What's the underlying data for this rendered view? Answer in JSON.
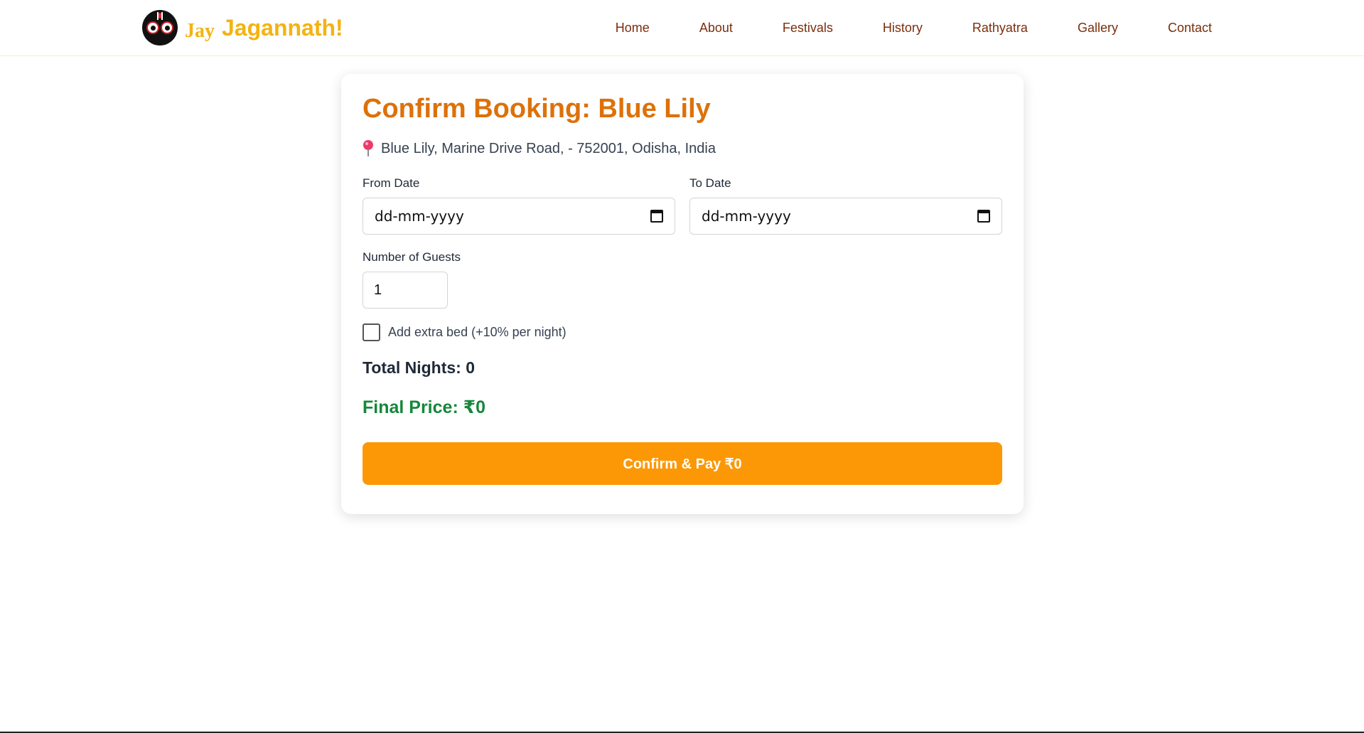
{
  "brand": {
    "prefix": "Jay",
    "name": "Jagannath!",
    "logo_icon": "jagannath-face-icon",
    "color": "#f3b311"
  },
  "nav": {
    "items": [
      {
        "label": "Home"
      },
      {
        "label": "About"
      },
      {
        "label": "Festivals"
      },
      {
        "label": "History"
      },
      {
        "label": "Rathyatra"
      },
      {
        "label": "Gallery"
      },
      {
        "label": "Contact"
      }
    ],
    "link_color": "#7a2e0c"
  },
  "booking": {
    "title": "Confirm Booking: Blue Lily",
    "address_icon": "location-pin-icon",
    "address": "Blue Lily, Marine Drive Road, - 752001, Odisha, India",
    "from_date": {
      "label": "From Date",
      "value": "dd-mm-yyyy"
    },
    "to_date": {
      "label": "To Date",
      "value": "dd-mm-yyyy"
    },
    "guests": {
      "label": "Number of Guests",
      "value": "1"
    },
    "extra_bed": {
      "label": "Add extra bed (+10% per night)",
      "checked": false
    },
    "total_nights": "Total Nights: 0",
    "final_price": "Final Price: ₹0",
    "pay_button": "Confirm & Pay ₹0"
  },
  "colors": {
    "title": "#dd7109",
    "price": "#16873a",
    "button": "#fc9806"
  }
}
